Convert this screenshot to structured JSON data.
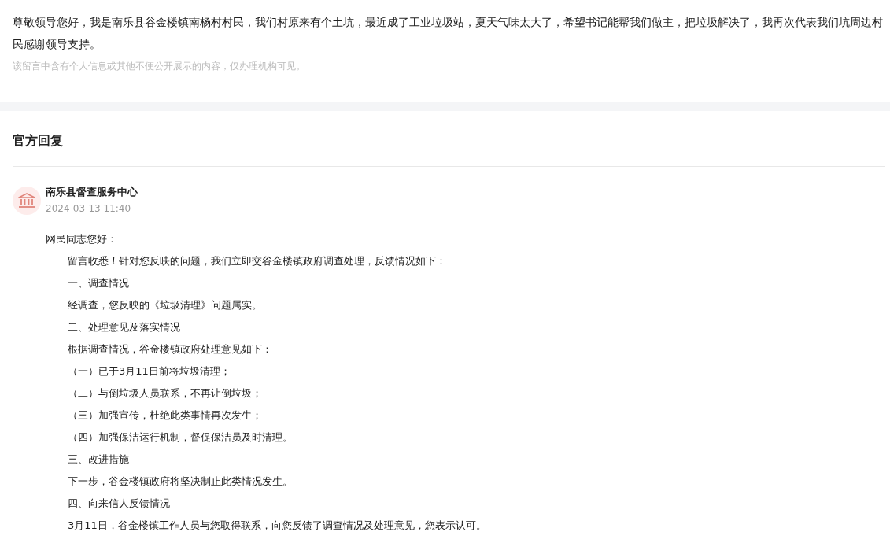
{
  "message": {
    "text": "尊敬领导您好，我是南乐县谷金楼镇南杨村村民，我们村原来有个土坑，最近成了工业垃圾站，夏天气味太大了，希望书记能帮我们做主，把垃圾解决了，我再次代表我们坑周边村民感谢领导支持。",
    "privacy_note": "该留言中含有个人信息或其他不便公开展示的内容，仅办理机构可见。"
  },
  "official_reply": {
    "title": "官方回复",
    "author": "南乐县督查服务中心",
    "time": "2024-03-13 11:40",
    "greeting": "网民同志您好：",
    "lines": [
      "留言收悉！针对您反映的问题，我们立即交谷金楼镇政府调查处理，反馈情况如下：",
      "一、调查情况",
      "经调查，您反映的《垃圾清理》问题属实。",
      "二、处理意见及落实情况",
      "根据调查情况，谷金楼镇政府处理意见如下：",
      "（一）已于3月11日前将垃圾清理；",
      "（二）与倒垃圾人员联系，不再让倒垃圾；",
      "（三）加强宣传，杜绝此类事情再次发生；",
      "（四）加强保洁运行机制，督促保洁员及时清理。",
      "三、改进措施",
      "下一步，谷金楼镇政府将坚决制止此类情况发生。",
      "四、向来信人反馈情况",
      "3月11日，谷金楼镇工作人员与您取得联系，向您反馈了调查情况及处理意见，您表示认可。"
    ]
  }
}
